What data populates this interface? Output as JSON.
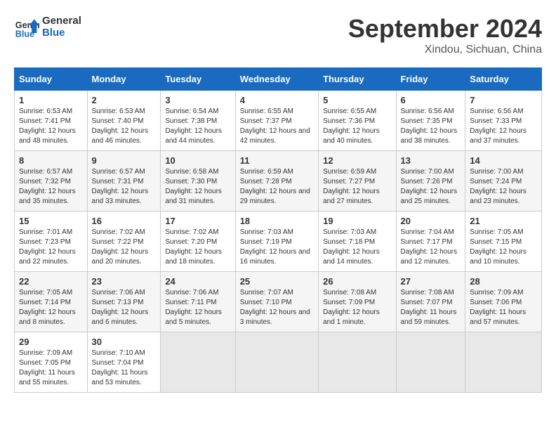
{
  "logo": {
    "text_general": "General",
    "text_blue": "Blue"
  },
  "header": {
    "month": "September 2024",
    "location": "Xindou, Sichuan, China"
  },
  "weekdays": [
    "Sunday",
    "Monday",
    "Tuesday",
    "Wednesday",
    "Thursday",
    "Friday",
    "Saturday"
  ],
  "weeks": [
    [
      {
        "day": "1",
        "sunrise": "6:53 AM",
        "sunset": "7:41 PM",
        "daylight": "12 hours and 48 minutes."
      },
      {
        "day": "2",
        "sunrise": "6:53 AM",
        "sunset": "7:40 PM",
        "daylight": "12 hours and 46 minutes."
      },
      {
        "day": "3",
        "sunrise": "6:54 AM",
        "sunset": "7:38 PM",
        "daylight": "12 hours and 44 minutes."
      },
      {
        "day": "4",
        "sunrise": "6:55 AM",
        "sunset": "7:37 PM",
        "daylight": "12 hours and 42 minutes."
      },
      {
        "day": "5",
        "sunrise": "6:55 AM",
        "sunset": "7:36 PM",
        "daylight": "12 hours and 40 minutes."
      },
      {
        "day": "6",
        "sunrise": "6:56 AM",
        "sunset": "7:35 PM",
        "daylight": "12 hours and 38 minutes."
      },
      {
        "day": "7",
        "sunrise": "6:56 AM",
        "sunset": "7:33 PM",
        "daylight": "12 hours and 37 minutes."
      }
    ],
    [
      {
        "day": "8",
        "sunrise": "6:57 AM",
        "sunset": "7:32 PM",
        "daylight": "12 hours and 35 minutes."
      },
      {
        "day": "9",
        "sunrise": "6:57 AM",
        "sunset": "7:31 PM",
        "daylight": "12 hours and 33 minutes."
      },
      {
        "day": "10",
        "sunrise": "6:58 AM",
        "sunset": "7:30 PM",
        "daylight": "12 hours and 31 minutes."
      },
      {
        "day": "11",
        "sunrise": "6:59 AM",
        "sunset": "7:28 PM",
        "daylight": "12 hours and 29 minutes."
      },
      {
        "day": "12",
        "sunrise": "6:59 AM",
        "sunset": "7:27 PM",
        "daylight": "12 hours and 27 minutes."
      },
      {
        "day": "13",
        "sunrise": "7:00 AM",
        "sunset": "7:26 PM",
        "daylight": "12 hours and 25 minutes."
      },
      {
        "day": "14",
        "sunrise": "7:00 AM",
        "sunset": "7:24 PM",
        "daylight": "12 hours and 23 minutes."
      }
    ],
    [
      {
        "day": "15",
        "sunrise": "7:01 AM",
        "sunset": "7:23 PM",
        "daylight": "12 hours and 22 minutes."
      },
      {
        "day": "16",
        "sunrise": "7:02 AM",
        "sunset": "7:22 PM",
        "daylight": "12 hours and 20 minutes."
      },
      {
        "day": "17",
        "sunrise": "7:02 AM",
        "sunset": "7:20 PM",
        "daylight": "12 hours and 18 minutes."
      },
      {
        "day": "18",
        "sunrise": "7:03 AM",
        "sunset": "7:19 PM",
        "daylight": "12 hours and 16 minutes."
      },
      {
        "day": "19",
        "sunrise": "7:03 AM",
        "sunset": "7:18 PM",
        "daylight": "12 hours and 14 minutes."
      },
      {
        "day": "20",
        "sunrise": "7:04 AM",
        "sunset": "7:17 PM",
        "daylight": "12 hours and 12 minutes."
      },
      {
        "day": "21",
        "sunrise": "7:05 AM",
        "sunset": "7:15 PM",
        "daylight": "12 hours and 10 minutes."
      }
    ],
    [
      {
        "day": "22",
        "sunrise": "7:05 AM",
        "sunset": "7:14 PM",
        "daylight": "12 hours and 8 minutes."
      },
      {
        "day": "23",
        "sunrise": "7:06 AM",
        "sunset": "7:13 PM",
        "daylight": "12 hours and 6 minutes."
      },
      {
        "day": "24",
        "sunrise": "7:06 AM",
        "sunset": "7:11 PM",
        "daylight": "12 hours and 5 minutes."
      },
      {
        "day": "25",
        "sunrise": "7:07 AM",
        "sunset": "7:10 PM",
        "daylight": "12 hours and 3 minutes."
      },
      {
        "day": "26",
        "sunrise": "7:08 AM",
        "sunset": "7:09 PM",
        "daylight": "12 hours and 1 minute."
      },
      {
        "day": "27",
        "sunrise": "7:08 AM",
        "sunset": "7:07 PM",
        "daylight": "11 hours and 59 minutes."
      },
      {
        "day": "28",
        "sunrise": "7:09 AM",
        "sunset": "7:06 PM",
        "daylight": "11 hours and 57 minutes."
      }
    ],
    [
      {
        "day": "29",
        "sunrise": "7:09 AM",
        "sunset": "7:05 PM",
        "daylight": "11 hours and 55 minutes."
      },
      {
        "day": "30",
        "sunrise": "7:10 AM",
        "sunset": "7:04 PM",
        "daylight": "11 hours and 53 minutes."
      },
      null,
      null,
      null,
      null,
      null
    ]
  ]
}
